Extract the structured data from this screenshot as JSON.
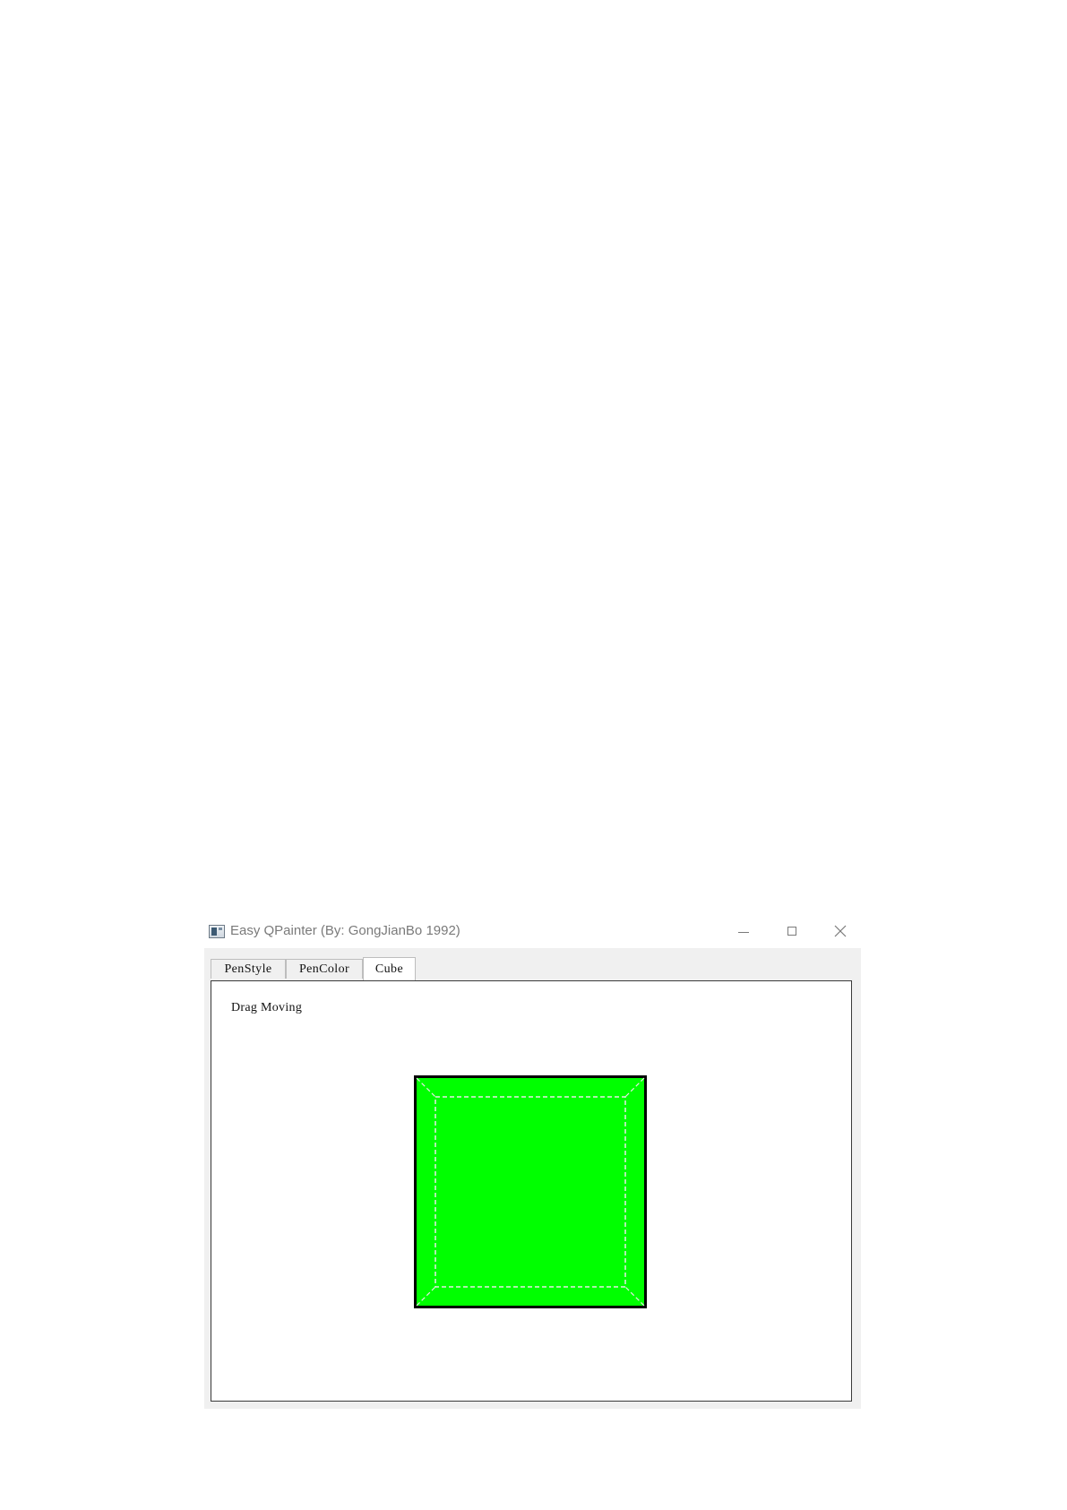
{
  "window": {
    "title": "Easy QPainter (By: GongJianBo 1992)",
    "icon": "app-window-icon"
  },
  "titlebar_buttons": {
    "minimize": "minimize-icon",
    "maximize": "maximize-icon",
    "close": "close-icon",
    "close_glyph": "✕"
  },
  "tabs": [
    {
      "label": "PenStyle",
      "active": false
    },
    {
      "label": "PenColor",
      "active": false
    },
    {
      "label": "Cube",
      "active": true
    }
  ],
  "cube_panel": {
    "hint": "Drag Moving",
    "face_color": "#00ff00",
    "edge_color": "#000000",
    "inner_line_color": "#e8e8e8",
    "inner_line_style": "dashed"
  }
}
